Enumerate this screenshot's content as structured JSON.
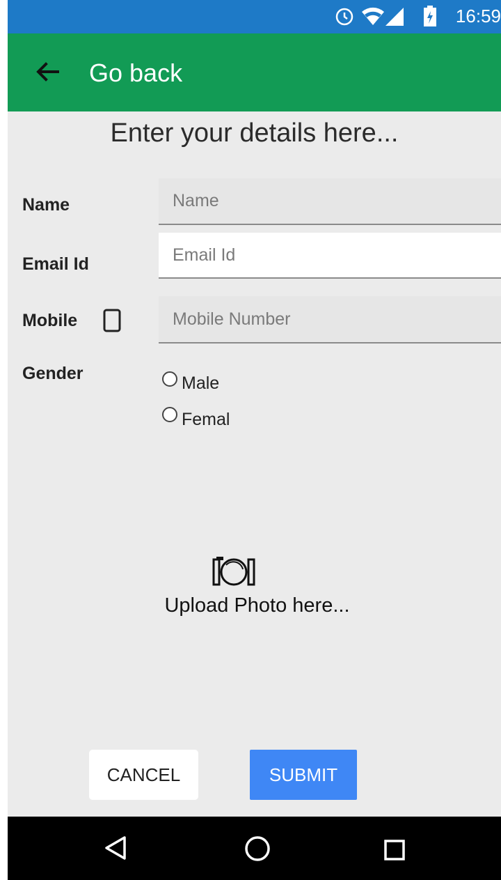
{
  "status_bar": {
    "time": "16:59",
    "icons": [
      "alarm-icon",
      "wifi-icon",
      "signal-icon",
      "battery-icon"
    ]
  },
  "app_bar": {
    "title": "Go back",
    "back_icon": "arrow-left-icon",
    "color": "#129b55"
  },
  "form": {
    "heading": "Enter your details here...",
    "name": {
      "label": "Name",
      "placeholder": "Name",
      "value": ""
    },
    "email": {
      "label": "Email Id",
      "placeholder": "Email Id",
      "value": ""
    },
    "mobile": {
      "label": "Mobile",
      "placeholder": "Mobile Number",
      "value": "",
      "icon": "phone-icon"
    },
    "gender": {
      "label": "Gender",
      "options": [
        "Male",
        "Femal"
      ]
    }
  },
  "upload": {
    "label": "Upload Photo here...",
    "icon": "camera-icon"
  },
  "buttons": {
    "cancel": "CANCEL",
    "submit": "SUBMIT",
    "submit_color": "#3f87f5"
  },
  "nav_bar": {
    "icons": [
      "back-triangle-icon",
      "home-circle-icon",
      "recents-square-icon"
    ]
  }
}
